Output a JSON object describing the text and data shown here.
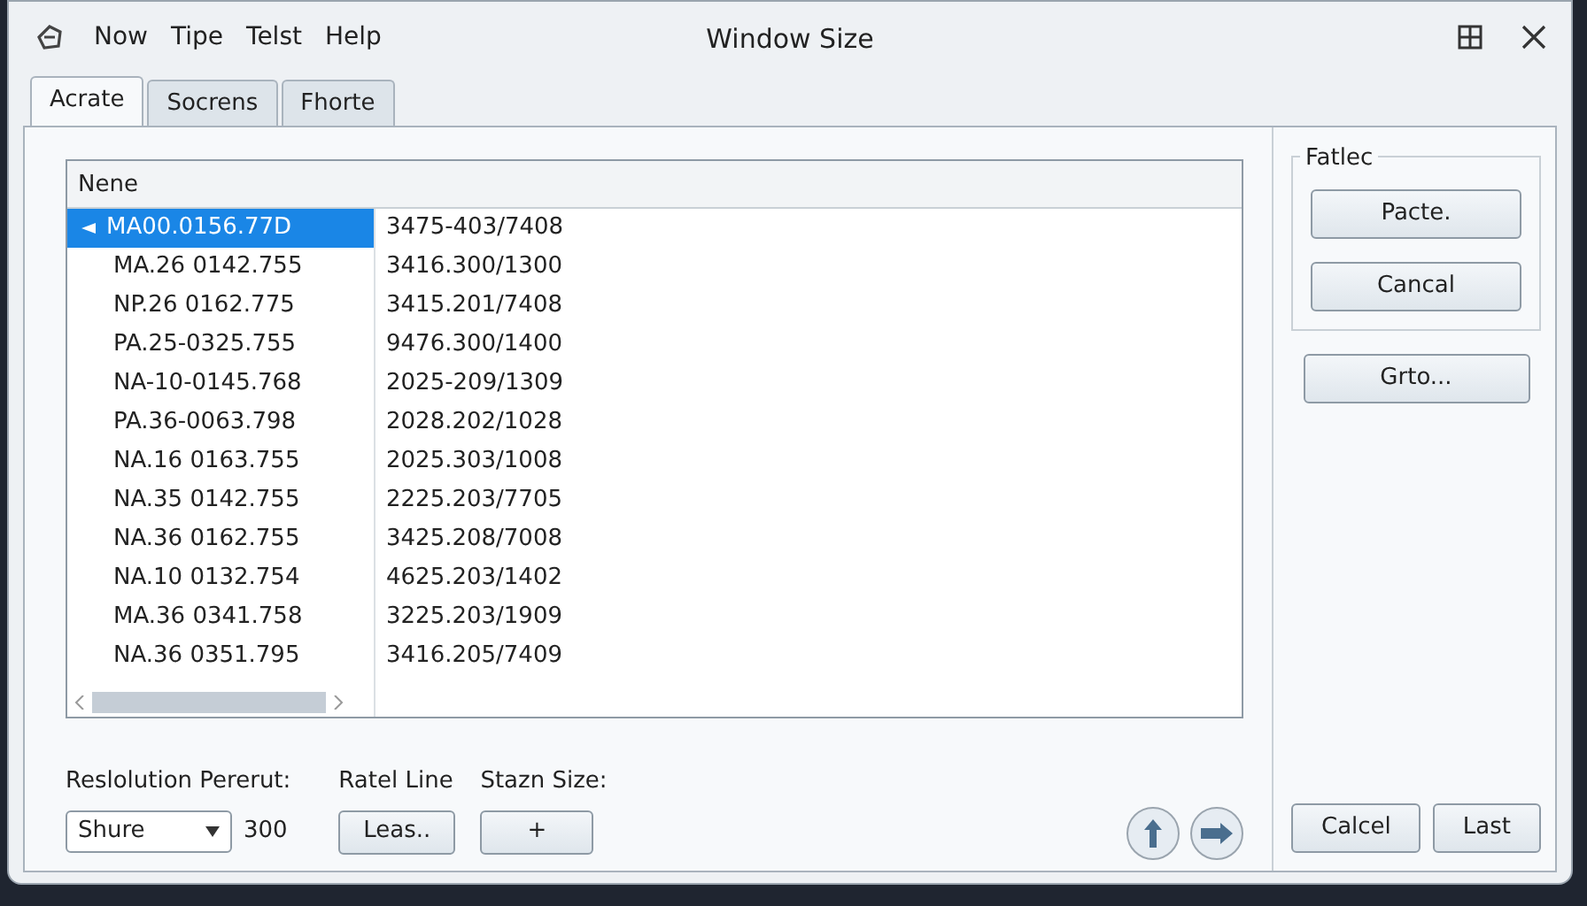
{
  "window": {
    "title": "Window Size"
  },
  "menu": [
    "Now",
    "Tipe",
    "Telst",
    "Help"
  ],
  "tabs": [
    {
      "label": "Acrate",
      "selected": true
    },
    {
      "label": "Socrens",
      "selected": false
    },
    {
      "label": "Fhorte",
      "selected": false
    }
  ],
  "list": {
    "header": "Nene",
    "rows": [
      {
        "cells": [
          "MA00.0156.77D",
          "3475-403/7408"
        ],
        "selected": true
      },
      {
        "cells": [
          "MA.26 0142.755",
          "3416.300/1300"
        ],
        "selected": false
      },
      {
        "cells": [
          "NP.26 0162.775",
          "3415.201/7408"
        ],
        "selected": false
      },
      {
        "cells": [
          "PA.25-0325.755",
          "9476.300/1400"
        ],
        "selected": false
      },
      {
        "cells": [
          "NA-10-0145.768",
          "2025-209/1309"
        ],
        "selected": false
      },
      {
        "cells": [
          "PA.36-0063.798",
          "2028.202/1028"
        ],
        "selected": false
      },
      {
        "cells": [
          "NA.16 0163.755",
          "2025.303/1008"
        ],
        "selected": false
      },
      {
        "cells": [
          "NA.35 0142.755",
          "2225.203/7705"
        ],
        "selected": false
      },
      {
        "cells": [
          "NA.36 0162.755",
          "3425.208/7008"
        ],
        "selected": false
      },
      {
        "cells": [
          "NA.10 0132.754",
          "4625.203/1402"
        ],
        "selected": false
      },
      {
        "cells": [
          "MA.36 0341.758",
          "3225.203/1909"
        ],
        "selected": false
      },
      {
        "cells": [
          "NA.36 0351.795",
          "3416.205/7409"
        ],
        "selected": false
      }
    ]
  },
  "side": {
    "group_title": "Fatlec",
    "group_buttons": [
      "Pacte.",
      "Cancal"
    ],
    "button": "Grto..."
  },
  "bottom": {
    "resolution_label": "Reslolution Pererut:",
    "resolution_value": "Shure",
    "resolution_number": "300",
    "line_label": "Ratel Line",
    "line_button": "Leas..",
    "size_label": "Stazn Size:",
    "size_button": "+"
  },
  "buttons": [
    "Calcel",
    "Last"
  ]
}
